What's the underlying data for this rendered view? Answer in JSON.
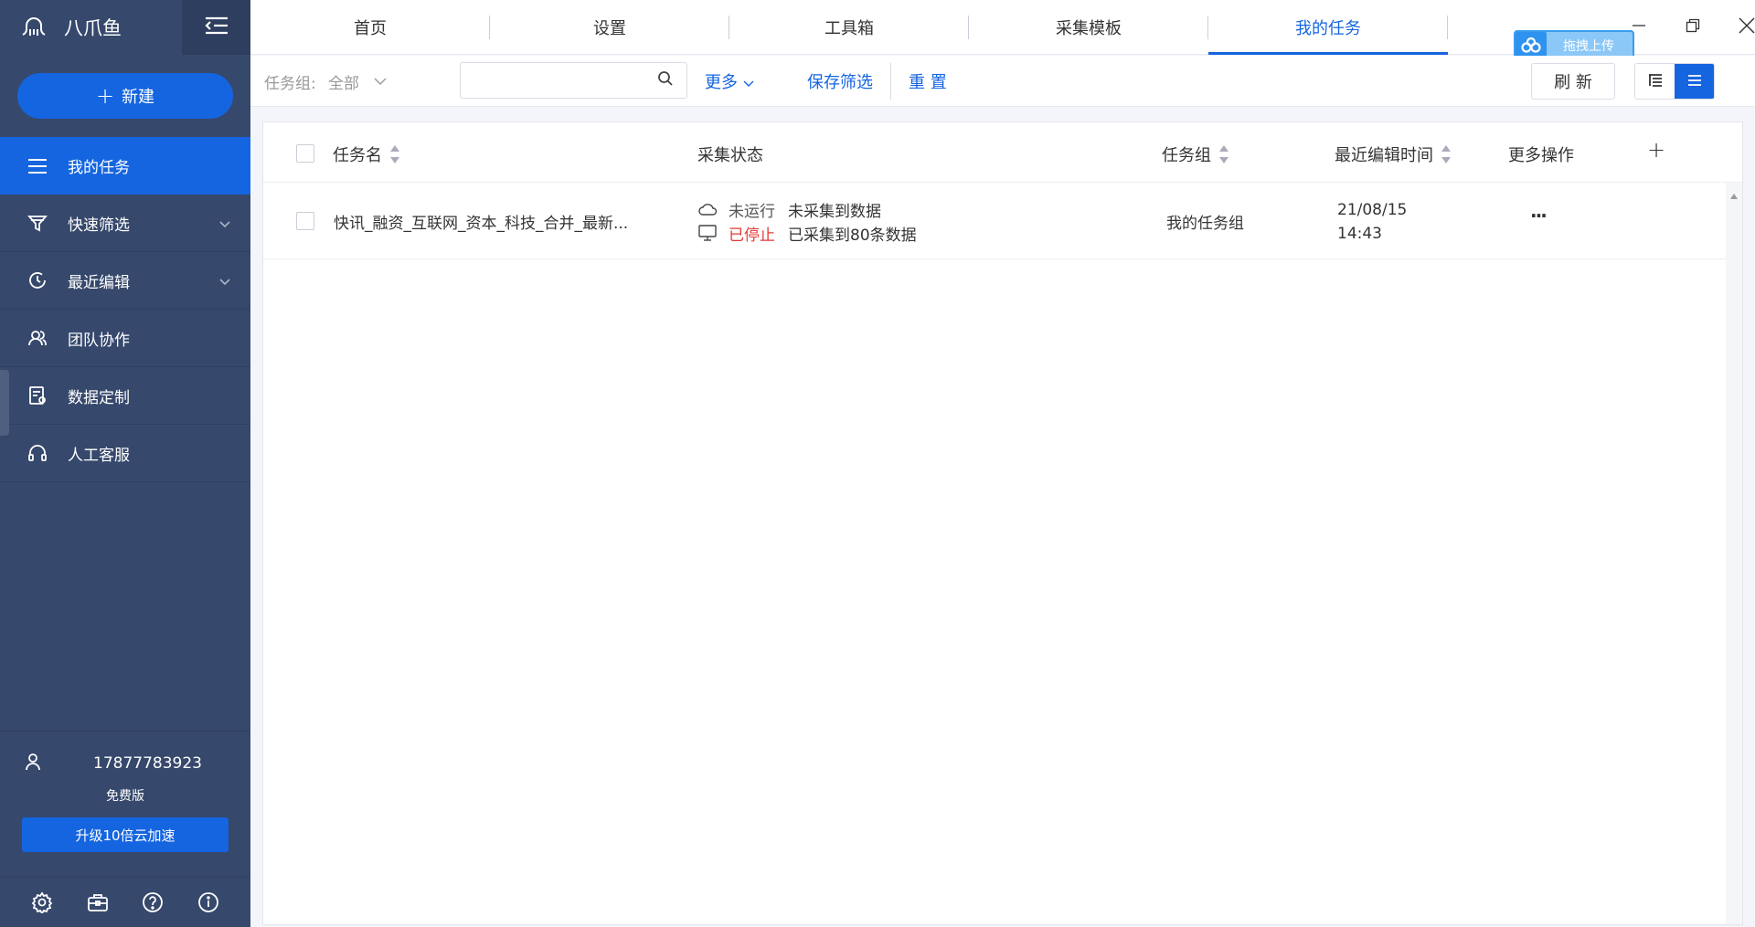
{
  "app": {
    "name": "八爪鱼"
  },
  "sidebar": {
    "new_label": "新建",
    "items": [
      {
        "label": "我的任务",
        "icon": "list-icon",
        "active": true
      },
      {
        "label": "快速筛选",
        "icon": "filter-icon",
        "expandable": true
      },
      {
        "label": "最近编辑",
        "icon": "recent-clock-icon",
        "expandable": true
      },
      {
        "label": "团队协作",
        "icon": "team-icon"
      },
      {
        "label": "数据定制",
        "icon": "data-custom-icon"
      },
      {
        "label": "人工客服",
        "icon": "headset-icon"
      }
    ],
    "user": {
      "phone": "17877783923",
      "plan": "免费版",
      "upgrade_label": "升级10倍云加速"
    },
    "bottom_icons": [
      "settings-icon",
      "toolbox-icon",
      "help-icon",
      "info-icon"
    ]
  },
  "tabs": [
    {
      "label": "首页"
    },
    {
      "label": "设置"
    },
    {
      "label": "工具箱"
    },
    {
      "label": "采集模板"
    },
    {
      "label": "我的任务",
      "active": true
    }
  ],
  "upload_badge": {
    "label": "拖拽上传"
  },
  "filter": {
    "group_label": "任务组:",
    "group_value": "全部",
    "search_value": "",
    "more_label": "更多",
    "save_label": "保存筛选",
    "reset_label": "重 置",
    "refresh_label": "刷 新"
  },
  "table": {
    "headers": {
      "name": "任务名",
      "status": "采集状态",
      "group": "任务组",
      "edited": "最近编辑时间",
      "actions": "更多操作",
      "add": "+"
    },
    "rows": [
      {
        "name": "快讯_融资_互联网_资本_科技_合并_最新...",
        "cloud_status": "未运行",
        "cloud_data": "未采集到数据",
        "local_status": "已停止",
        "local_data": "已采集到80条数据",
        "group": "我的任务组",
        "date": "21/08/15",
        "time": "14:43",
        "more": "···"
      }
    ]
  },
  "colors": {
    "sidebar": "#36486c",
    "accent": "#1565e0",
    "stopped": "#e53935"
  }
}
